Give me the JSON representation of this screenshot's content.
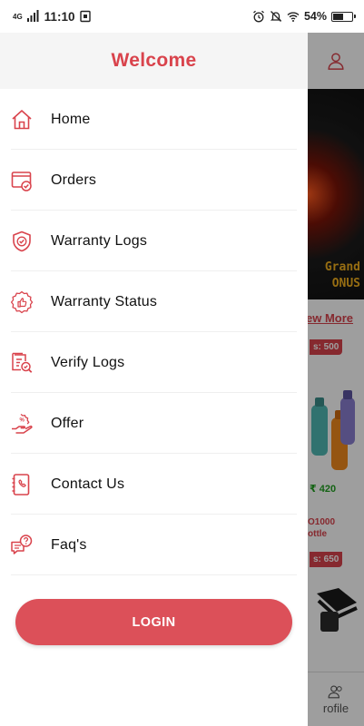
{
  "status_bar": {
    "network": "4G",
    "time": "11:10",
    "battery_percent": "54%",
    "battery_level": 0.54
  },
  "drawer": {
    "title": "Welcome",
    "accent_color": "#d9434c",
    "menu": [
      {
        "label": "Home",
        "icon": "home-icon"
      },
      {
        "label": "Orders",
        "icon": "orders-icon"
      },
      {
        "label": "Warranty Logs",
        "icon": "shield-check-icon"
      },
      {
        "label": "Warranty Status",
        "icon": "badge-thumb-icon"
      },
      {
        "label": "Verify Logs",
        "icon": "verify-document-icon"
      },
      {
        "label": "Offer",
        "icon": "offer-hand-icon"
      },
      {
        "label": "Contact Us",
        "icon": "phone-book-icon"
      },
      {
        "label": "Faq's",
        "icon": "faq-chat-icon"
      }
    ],
    "login_label": "LOGIN"
  },
  "background_app": {
    "banner_text_1": "Grand",
    "banner_text_2": "ONUS",
    "view_more": "ew More",
    "card1_badge": "s: 500",
    "card1_price": "₹ 420",
    "card1_name_1": "O1000",
    "card1_name_2": "ottle",
    "card2_badge": "s: 650",
    "bottom_label": "rofile"
  }
}
